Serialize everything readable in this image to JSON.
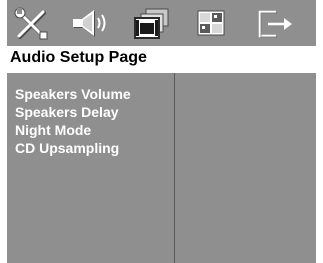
{
  "tabs": [
    {
      "icon": "tools-icon"
    },
    {
      "icon": "speaker-icon"
    },
    {
      "icon": "video-screens-icon"
    },
    {
      "icon": "preference-grid-icon"
    },
    {
      "icon": "exit-icon"
    }
  ],
  "page_title": "Audio Setup Page",
  "menu": {
    "items": [
      {
        "label": "Speakers Volume"
      },
      {
        "label": "Speakers Delay"
      },
      {
        "label": "Night Mode"
      },
      {
        "label": "CD Upsampling"
      }
    ]
  },
  "colors": {
    "background": "#8f8f8f",
    "title_bar": "#ffffff",
    "menu_text": "#ffffff",
    "icon": "#ffffff",
    "icon_shadow": "#4a4a4a"
  }
}
